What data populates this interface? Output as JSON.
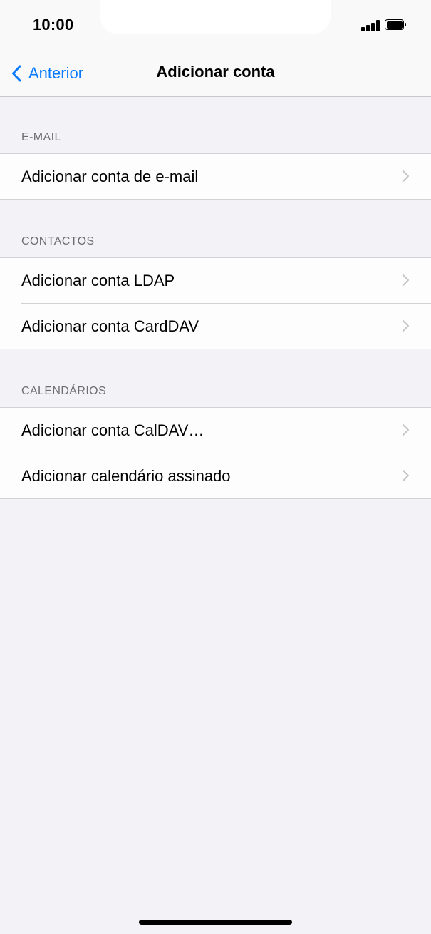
{
  "status_bar": {
    "time": "10:00"
  },
  "nav": {
    "back_label": "Anterior",
    "title": "Adicionar conta",
    "accent_color": "#0a7aff"
  },
  "sections": [
    {
      "header": "E-MAIL",
      "items": [
        "Adicionar conta de e-mail"
      ]
    },
    {
      "header": "CONTACTOS",
      "items": [
        "Adicionar conta LDAP",
        "Adicionar conta CardDAV"
      ]
    },
    {
      "header": "CALENDÁRIOS",
      "items": [
        "Adicionar conta CalDAV…",
        "Adicionar calendário assinado"
      ]
    }
  ],
  "icons": {
    "back": "chevron-left-icon",
    "disclosure": "chevron-right-icon",
    "signal": "cellular-signal-icon",
    "battery": "battery-icon"
  }
}
